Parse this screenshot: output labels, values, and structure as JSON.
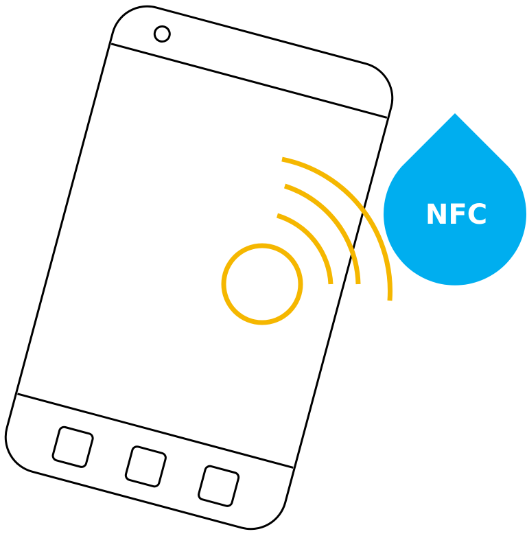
{
  "badge": {
    "label": "NFC"
  },
  "colors": {
    "outline": "#000000",
    "waves": "#F5B700",
    "badge": "#00AEEF",
    "badge_text": "#FFFFFF",
    "background": "#FFFFFF"
  },
  "icons": {
    "phone": "phone-icon",
    "camera": "camera-icon",
    "signal": "nfc-signal-icon",
    "badge": "nfc-drop-badge-icon"
  }
}
